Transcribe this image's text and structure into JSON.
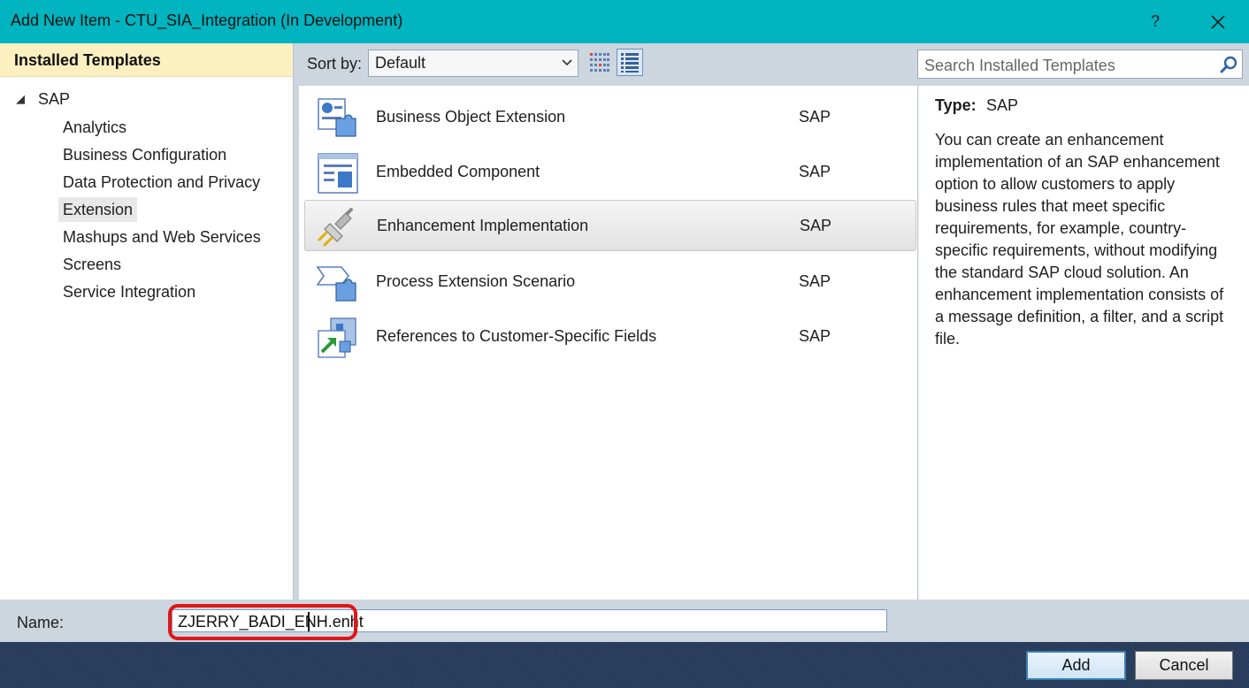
{
  "window": {
    "title": "Add New Item - CTU_SIA_Integration (In Development)",
    "help_label": "?",
    "close_icon": "close-icon",
    "titlebar_color": "#00b4c0"
  },
  "sidebar": {
    "header": "Installed Templates",
    "root": {
      "label": "SAP",
      "expanded_icon": "tree-expanded-triangle-icon"
    },
    "items": [
      {
        "label": "Analytics"
      },
      {
        "label": "Business Configuration"
      },
      {
        "label": "Data Protection and Privacy"
      },
      {
        "label": "Extension",
        "selected": true
      },
      {
        "label": "Mashups and Web Services"
      },
      {
        "label": "Screens"
      },
      {
        "label": "Service Integration"
      }
    ]
  },
  "toolbar": {
    "sort_label": "Sort by:",
    "sort_value": "Default",
    "view_medium_icon": "medium-icons-view-icon",
    "view_small_icon": "small-icons-view-icon",
    "search_placeholder": "Search Installed Templates",
    "search_icon": "search-icon"
  },
  "templates": [
    {
      "name": "Business Object Extension",
      "category": "SAP",
      "icon": "business-object-extension-icon"
    },
    {
      "name": "Embedded Component",
      "category": "SAP",
      "icon": "embedded-component-icon"
    },
    {
      "name": "Enhancement Implementation",
      "category": "SAP",
      "icon": "plug-icon",
      "selected": true
    },
    {
      "name": "Process Extension Scenario",
      "category": "SAP",
      "icon": "process-extension-icon"
    },
    {
      "name": "References to Customer-Specific Fields",
      "category": "SAP",
      "icon": "customer-fields-reference-icon"
    }
  ],
  "description": {
    "type_label": "Type:",
    "type_value": "SAP",
    "text": "You can create an enhancement implementation of an SAP enhancement option to allow customers to apply business rules that meet specific requirements, for example, country-specific requirements, without modifying the standard SAP cloud solution. An enhancement implementation consists of a message definition, a filter, and a script file."
  },
  "name_field": {
    "label": "Name:",
    "value": "ZJERRY_BADI_ENH.enht"
  },
  "buttons": {
    "add": "Add",
    "cancel": "Cancel"
  },
  "colors": {
    "highlight": "#e01616",
    "footer": "#263a5a",
    "panel_bar": "#cdd5df"
  }
}
